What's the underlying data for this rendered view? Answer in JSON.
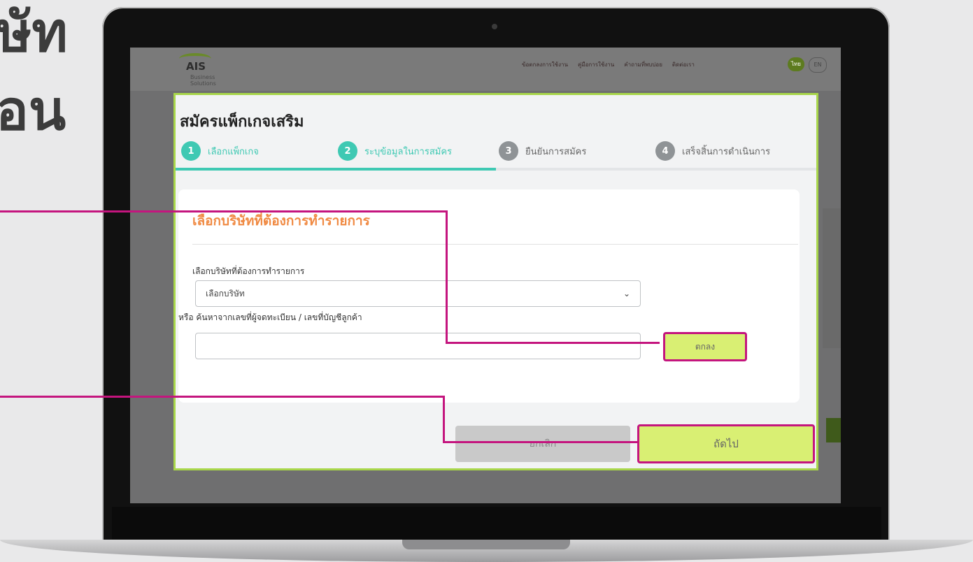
{
  "slide_title": {
    "line1": "ษัท",
    "line2": "ื่อน"
  },
  "site": {
    "logo": {
      "name": "AIS",
      "sub": "Business Solutions"
    },
    "nav": [
      "ข้อตกลงการใช้งาน",
      "คู่มือการใช้งาน",
      "คำถามที่พบบ่อย",
      "ติดต่อเรา"
    ],
    "lang": {
      "th": "ไทย",
      "en": "EN"
    }
  },
  "modal": {
    "title": "สมัครแพ็กเกจเสริม",
    "steps": [
      {
        "num": "1",
        "label": "เลือกแพ็กเกจ",
        "active": true
      },
      {
        "num": "2",
        "label": "ระบุข้อมูลในการสมัคร",
        "active": true
      },
      {
        "num": "3",
        "label": "ยืนยันการสมัคร",
        "active": false
      },
      {
        "num": "4",
        "label": "เสร็จสิ้นการดำเนินการ",
        "active": false
      }
    ],
    "progress": 0.5,
    "card": {
      "title": "เลือกบริษัทที่ต้องการทำรายการ",
      "field_label": "เลือกบริษัทที่ต้องการทำรายการ",
      "select_value": "เลือกบริษัท",
      "or_label": "หรือ ค้นหาจากเลขที่ผู้จดทะเบียน / เลขที่บัญชีลูกค้า",
      "search_value": "",
      "ok_label": "ตกลง"
    },
    "cancel_label": "ยกเลิก",
    "next_label": "ถัดไป"
  },
  "colors": {
    "accent": "#3fc9b3",
    "title_orange": "#f08a43",
    "button_green": "#d9ef73",
    "highlight": "#c4157e",
    "modal_border": "#a8d64a"
  }
}
